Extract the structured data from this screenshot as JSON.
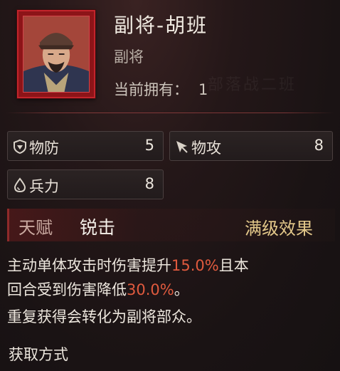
{
  "general": {
    "name": "副将-胡班",
    "rank": "副将",
    "owned_label": "当前拥有：",
    "owned_count": "1",
    "watermark": "部落战二班"
  },
  "stats": {
    "defense": {
      "label": "物防",
      "value": "5",
      "icon": "shield-icon"
    },
    "attack": {
      "label": "物攻",
      "value": "8",
      "icon": "arrow-cursor-icon"
    },
    "troops": {
      "label": "兵力",
      "value": "8",
      "icon": "droplet-icon"
    }
  },
  "talent": {
    "label": "天赋",
    "name": "锐击",
    "effect_label": "满级效果"
  },
  "description": {
    "line1_pre": "主动单体攻击时伤害提升",
    "line1_hl": "15.0%",
    "line1_post": "且本",
    "line2_pre": "回合受到伤害降低",
    "line2_hl": "30.0%",
    "line2_post": "。",
    "line3": "重复获得会转化为副将部众。"
  },
  "acquire": {
    "title": "获取方式"
  },
  "colors": {
    "frame_red": "#c2242b",
    "highlight": "#e05a3e",
    "gold": "#e3c88a"
  }
}
